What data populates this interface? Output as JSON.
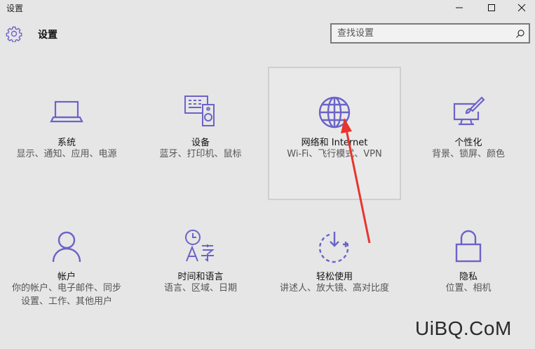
{
  "window": {
    "title": "设置"
  },
  "header": {
    "title": "设置",
    "search_placeholder": "查找设置"
  },
  "tiles": [
    {
      "label": "系统",
      "desc": "显示、通知、应用、电源",
      "icon": "laptop-icon"
    },
    {
      "label": "设备",
      "desc": "蓝牙、打印机、鼠标",
      "icon": "devices-icon"
    },
    {
      "label": "网络和 Internet",
      "desc": "Wi-Fi、飞行模式、VPN",
      "icon": "globe-icon"
    },
    {
      "label": "个性化",
      "desc": "背景、锁屏、颜色",
      "icon": "paint-icon"
    },
    {
      "label": "帐户",
      "desc": "你的帐户、电子邮件、同步设置、工作、其他用户",
      "icon": "person-icon"
    },
    {
      "label": "时间和语言",
      "desc": "语言、区域、日期",
      "icon": "time-language-icon"
    },
    {
      "label": "轻松使用",
      "desc": "讲述人、放大镜、高对比度",
      "icon": "ease-of-access-icon"
    },
    {
      "label": "隐私",
      "desc": "位置、相机",
      "icon": "lock-icon"
    }
  ],
  "colors": {
    "accent": "#6b63c9",
    "annotation_arrow": "#e8342c"
  },
  "watermark": "UiBQ.CoM"
}
